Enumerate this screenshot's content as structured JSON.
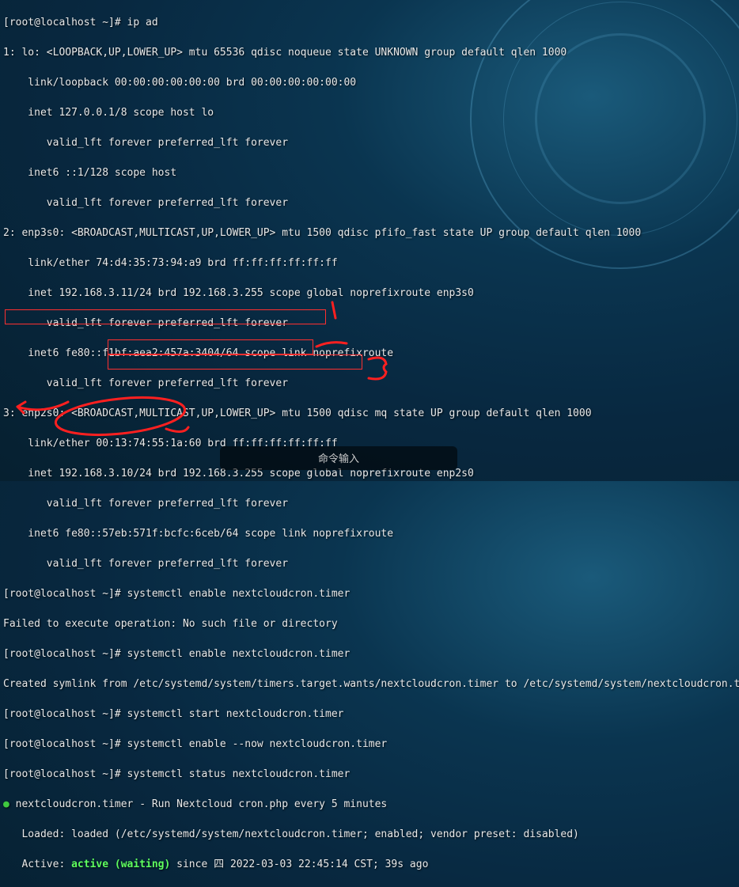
{
  "terminal": {
    "lines": [
      "[root@localhost ~]# ip ad",
      "1: lo: <LOOPBACK,UP,LOWER_UP> mtu 65536 qdisc noqueue state UNKNOWN group default qlen 1000",
      "    link/loopback 00:00:00:00:00:00 brd 00:00:00:00:00:00",
      "    inet 127.0.0.1/8 scope host lo",
      "       valid_lft forever preferred_lft forever",
      "    inet6 ::1/128 scope host",
      "       valid_lft forever preferred_lft forever",
      "2: enp3s0: <BROADCAST,MULTICAST,UP,LOWER_UP> mtu 1500 qdisc pfifo_fast state UP group default qlen 1000",
      "    link/ether 74:d4:35:73:94:a9 brd ff:ff:ff:ff:ff:ff",
      "    inet 192.168.3.11/24 brd 192.168.3.255 scope global noprefixroute enp3s0",
      "       valid_lft forever preferred_lft forever",
      "    inet6 fe80::f1bf:aea2:457a:3404/64 scope link noprefixroute",
      "       valid_lft forever preferred_lft forever",
      "3: enp2s0: <BROADCAST,MULTICAST,UP,LOWER_UP> mtu 1500 qdisc mq state UP group default qlen 1000",
      "    link/ether 00:13:74:55:1a:60 brd ff:ff:ff:ff:ff:ff",
      "    inet 192.168.3.10/24 brd 192.168.3.255 scope global noprefixroute enp2s0",
      "       valid_lft forever preferred_lft forever",
      "    inet6 fe80::57eb:571f:bcfc:6ceb/64 scope link noprefixroute",
      "       valid_lft forever preferred_lft forever",
      "[root@localhost ~]# systemctl enable nextcloudcron.timer",
      "Failed to execute operation: No such file or directory",
      "[root@localhost ~]# systemctl enable nextcloudcron.timer",
      "Created symlink from /etc/systemd/system/timers.target.wants/nextcloudcron.timer to /etc/systemd/system/nextcloudcron.timer.",
      "[root@localhost ~]# systemctl start nextcloudcron.timer",
      "[root@localhost ~]# systemctl enable --now nextcloudcron.timer",
      "[root@localhost ~]# systemctl status nextcloudcron.timer"
    ],
    "status": {
      "bullet": "●",
      "unit_line": " nextcloudcron.timer - Run Nextcloud cron.php every 5 minutes",
      "loaded_label": "   Loaded: ",
      "loaded_value": "loaded (/etc/systemd/system/nextcloudcron.timer; enabled; vendor preset: disabled)",
      "active_label": "   Active: ",
      "active_state": "active (waiting)",
      "active_since": " since 四 2022-03-03 22:45:14 CST; 39s ago"
    }
  },
  "annotations": {
    "mark1": "1",
    "mark2": "3"
  },
  "input_bar": {
    "placeholder": "命令输入"
  }
}
